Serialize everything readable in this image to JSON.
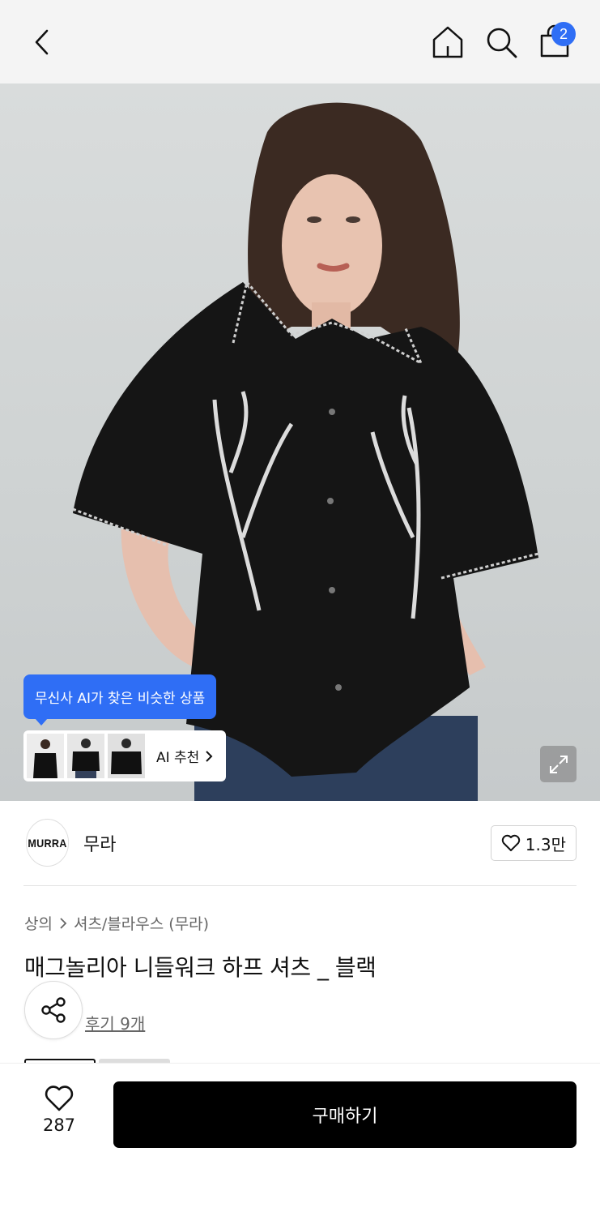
{
  "header": {
    "cart_count": "2",
    "icons": [
      "back-arrow-icon",
      "home-icon",
      "search-icon",
      "shopping-bag-icon"
    ]
  },
  "hero": {
    "ai_tooltip": "무신사 AI가 찾은 비슷한 상품",
    "ai_recommend_label": "AI 추천"
  },
  "brand": {
    "logo_text": "MURRA",
    "name": "무라",
    "likes": "1.3만"
  },
  "product": {
    "breadcrumb": [
      "상의",
      "셔츠/블라우스 (무라)"
    ],
    "title": "매그놀리아 니들워크 하프 셔츠 _ 블랙",
    "reviews": "후기 9개"
  },
  "bottom": {
    "wish_count": "287",
    "buy_label": "구매하기"
  },
  "colors": {
    "accent_blue": "#2f6ef5",
    "buy_button": "#000000"
  }
}
